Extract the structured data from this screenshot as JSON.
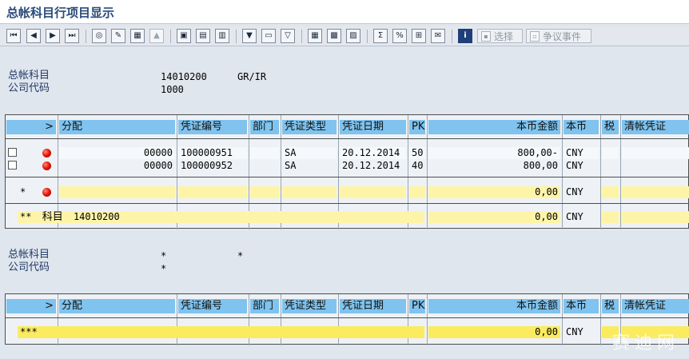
{
  "window": {
    "title": "总帐科目行项目显示"
  },
  "toolbar": {
    "select_label": "选择",
    "event_label": "争议事件",
    "buttons": [
      {
        "name": "first-page-icon",
        "glyph": "⏮"
      },
      {
        "name": "prev-page-icon",
        "glyph": "◀"
      },
      {
        "name": "next-page-icon",
        "glyph": "▶"
      },
      {
        "name": "last-page-icon",
        "glyph": "⏭"
      },
      {
        "name": "glasses-icon",
        "glyph": "◎"
      },
      {
        "name": "pencil-icon",
        "glyph": "✎"
      },
      {
        "name": "grid-icon",
        "glyph": "▦"
      },
      {
        "name": "stamp-icon",
        "glyph": "▲"
      },
      {
        "name": "doc-overview-icon",
        "glyph": "▣"
      },
      {
        "name": "doc-display-icon",
        "glyph": "▤"
      },
      {
        "name": "doc-print-icon",
        "glyph": "▥"
      },
      {
        "name": "filter-icon",
        "glyph": "▼"
      },
      {
        "name": "print-icon",
        "glyph": "▭"
      },
      {
        "name": "filter-set-icon",
        "glyph": "▽"
      },
      {
        "name": "layout-icon",
        "glyph": "▦"
      },
      {
        "name": "layout-change-icon",
        "glyph": "▩"
      },
      {
        "name": "layout-save-icon",
        "glyph": "▨"
      },
      {
        "name": "sum-icon",
        "glyph": "Σ"
      },
      {
        "name": "subtotal-icon",
        "glyph": "%"
      },
      {
        "name": "export-icon",
        "glyph": "⊞"
      },
      {
        "name": "mail-icon",
        "glyph": "✉"
      },
      {
        "name": "info-icon",
        "glyph": "i"
      },
      {
        "name": "select-icon",
        "glyph": "▪"
      },
      {
        "name": "event-icon",
        "glyph": "▫"
      }
    ]
  },
  "section1": {
    "account_label": "总帐科目",
    "account_value": "14010200",
    "account_desc": "GR/IR",
    "company_label": "公司代码",
    "company_value": "1000"
  },
  "section2": {
    "account_label": "总帐科目",
    "account_value": "*",
    "account_desc": "*",
    "company_label": "公司代码",
    "company_value": "*"
  },
  "columns": {
    "expand": ">",
    "assignment": "分配",
    "doc_no": "凭证编号",
    "dept": "部门",
    "doc_type": "凭证类型",
    "doc_date": "凭证日期",
    "pk": "PK",
    "amount": "本币金额",
    "currency": "本币",
    "tax": "税",
    "clearing": "清帐凭证"
  },
  "rows": [
    {
      "assignment": "00000",
      "doc_no": "100000951",
      "doc_type": "SA",
      "doc_date": "20.12.2014",
      "pk": "50",
      "amount": "800,00-",
      "currency": "CNY"
    },
    {
      "assignment": "00000",
      "doc_no": "100000952",
      "doc_type": "SA",
      "doc_date": "20.12.2014",
      "pk": "40",
      "amount": "800,00",
      "currency": "CNY"
    }
  ],
  "subtotal": {
    "marker": "*",
    "amount": "0,00",
    "currency": "CNY"
  },
  "account_total": {
    "marker": "**",
    "label": "科目",
    "account": "14010200",
    "amount": "0,00",
    "currency": "CNY"
  },
  "grand_total": {
    "marker": "***",
    "amount": "0,00",
    "currency": "CNY"
  },
  "watermark": "赛迪网"
}
